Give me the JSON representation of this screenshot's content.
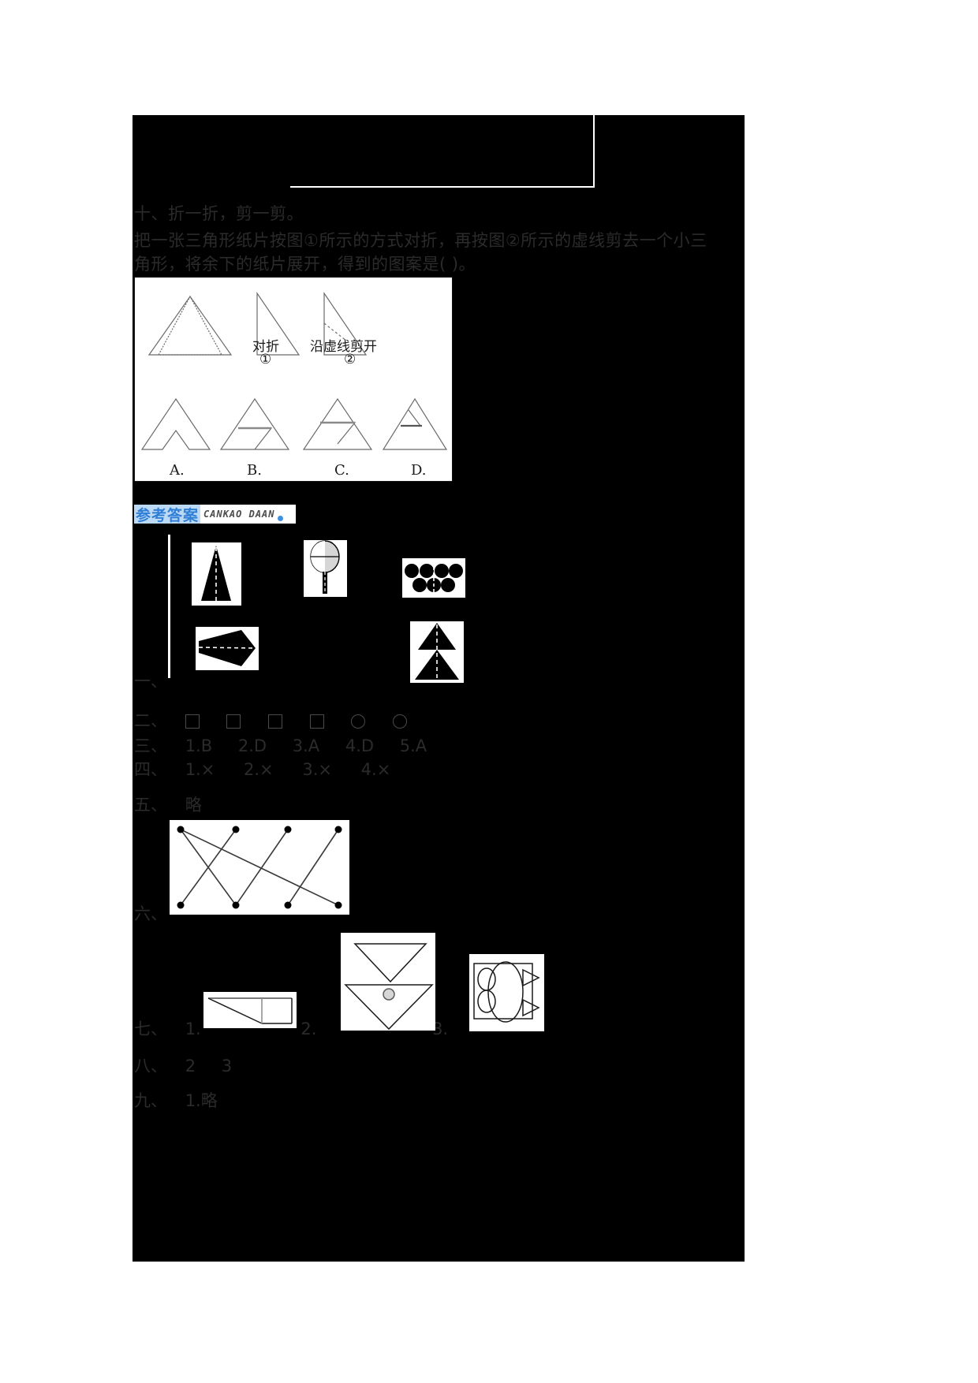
{
  "document": {
    "type": "worksheet-answer-key",
    "language": "zh-CN"
  },
  "question": {
    "heading": "十、折一折，剪一剪。",
    "line1": "把一张三角形纸片按图①所示的方式对折，再按图②所示的虚线剪去一个小三",
    "line2": "角形，将余下的纸片展开，得到的图案是(          )。",
    "figure": {
      "fold_label": "对折",
      "fold_number": "①",
      "cut_label": "沿虚线剪开",
      "cut_number": "②",
      "options": [
        "A.",
        "B.",
        "C.",
        "D."
      ]
    }
  },
  "answer_banner": {
    "chinese": "参考答案",
    "pinyin": "CANKAO DAAN",
    "accent_color": "#2f7fd6",
    "highlight_color": "#bcd9f5"
  },
  "answers": {
    "one": {
      "number": "一、",
      "content": ""
    },
    "two": {
      "number": "二、",
      "shapes": [
        "square",
        "square",
        "square",
        "square",
        "circle",
        "circle"
      ]
    },
    "three": {
      "number": "三、",
      "items": [
        "1.B",
        "2.D",
        "3.A",
        "4.D",
        "5.A"
      ]
    },
    "four": {
      "number": "四、",
      "items": [
        "1.×",
        "2.×",
        "3.×",
        "4.×"
      ]
    },
    "five": {
      "number": "五、",
      "content": "略"
    },
    "six": {
      "number": "六、",
      "content": ""
    },
    "seven": {
      "number": "七、",
      "items": [
        "1.",
        "2.",
        "3."
      ]
    },
    "eight": {
      "number": "八、",
      "items": [
        "2",
        "3"
      ]
    },
    "nine": {
      "number": "九、",
      "content": "1.略"
    }
  }
}
